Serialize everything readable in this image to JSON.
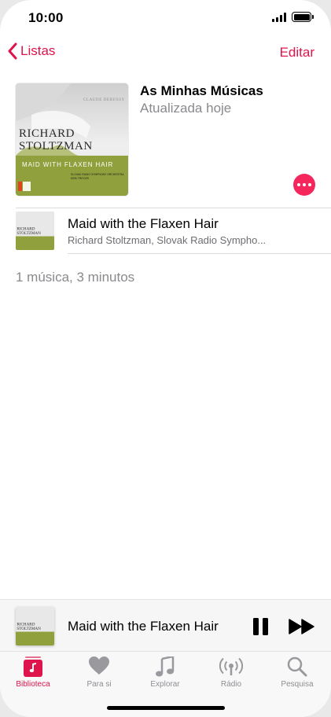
{
  "status_bar": {
    "time": "10:00"
  },
  "nav": {
    "back_label": "Listas",
    "edit_label": "Editar"
  },
  "playlist": {
    "title": "As Minhas Músicas",
    "subtitle": "Atualizada hoje",
    "summary": "1 música, 3 minutos"
  },
  "album_art": {
    "composer": "CLAUDE DEBUSSY",
    "artist_line1": "RICHARD",
    "artist_line2": "STOLTZMAN",
    "album": "MAID WITH FLAXEN HAIR",
    "orchestra": "SLOVAK RADIO SYMPHONY ORCHESTRA",
    "conductor": "KIRK TREVOR"
  },
  "songs": [
    {
      "title": "Maid with the Flaxen Hair",
      "artist": "Richard Stoltzman, Slovak Radio Sympho..."
    }
  ],
  "now_playing": {
    "title": "Maid with the Flaxen Hair"
  },
  "tabs": [
    {
      "label": "Biblioteca",
      "icon": "library-icon",
      "active": true
    },
    {
      "label": "Para si",
      "icon": "heart-icon",
      "active": false
    },
    {
      "label": "Explorar",
      "icon": "music-note-icon",
      "active": false
    },
    {
      "label": "Rádio",
      "icon": "radio-icon",
      "active": false
    },
    {
      "label": "Pesquisa",
      "icon": "search-icon",
      "active": false
    }
  ],
  "colors": {
    "accent": "#e0144c",
    "more_button": "#f5265c",
    "album_green": "#8fa03c"
  }
}
